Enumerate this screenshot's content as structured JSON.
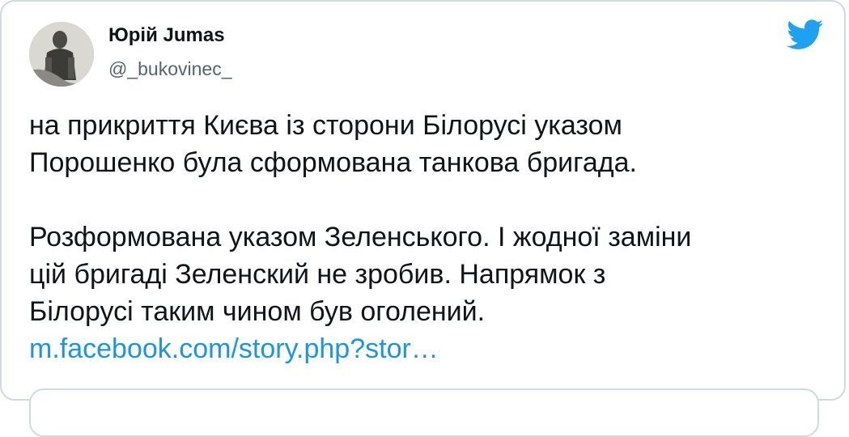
{
  "tweet": {
    "author": {
      "display_name": "Юрій Jumas",
      "handle": "@_bukovinec_",
      "avatar_icon": "user-avatar-photo"
    },
    "brand_icon": "twitter-bird-icon",
    "brand_color": "#1da1f2",
    "link_color": "#1b95e0",
    "text_lines_paragraph_1": [
      "на прикриття Києва із сторони Білорусі указом",
      "Порошенко була сформована танкова бригада."
    ],
    "text_lines_paragraph_2": [
      "Розформована указом Зеленського. І жодної заміни",
      "цій бригаді Зеленский не зробив. Напрямок з",
      "Білорусі таким чином був оголений."
    ],
    "link_text": "m.facebook.com/story.php?stor…"
  }
}
